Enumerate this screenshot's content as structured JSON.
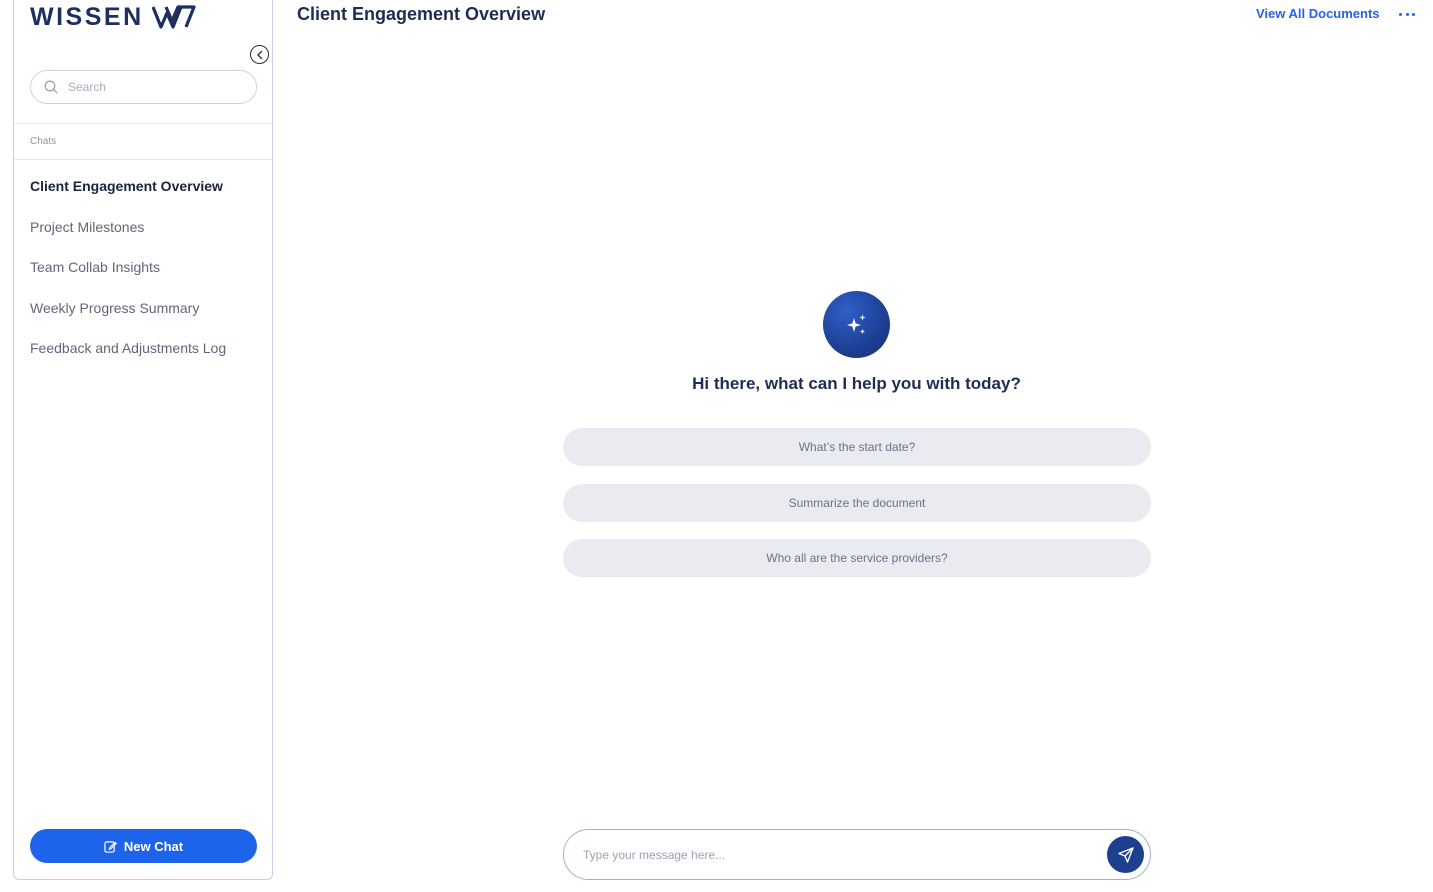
{
  "brand": {
    "name": "WISSEN"
  },
  "sidebar": {
    "search_placeholder": "Search",
    "section_label": "Chats",
    "chats": [
      {
        "label": "Client Engagement Overview",
        "active": true
      },
      {
        "label": "Project Milestones",
        "active": false
      },
      {
        "label": "Team Collab Insights",
        "active": false
      },
      {
        "label": "Weekly Progress Summary",
        "active": false
      },
      {
        "label": "Feedback and Adjustments Log",
        "active": false
      }
    ],
    "new_chat_label": "New Chat"
  },
  "header": {
    "title": "Client Engagement Overview",
    "view_all_label": "View All Documents"
  },
  "main": {
    "greeting": "Hi there, what can I help you with today?",
    "suggestions": [
      "What’s the start date?",
      "Summarize the document",
      "Who all are the service providers?"
    ]
  },
  "composer": {
    "placeholder": "Type your message here..."
  },
  "icons": {
    "collapse": "chevron-left-icon",
    "search": "search-icon",
    "new_chat": "edit-icon",
    "more": "ellipsis-icon",
    "assistant": "sparkles-icon",
    "send": "send-icon"
  },
  "colors": {
    "accent": "#1e64ea",
    "brand_navy": "#1c2f5e",
    "link": "#2563eb",
    "send_button": "#1c3f8f",
    "suggestion_bg": "#e9ebf0"
  }
}
